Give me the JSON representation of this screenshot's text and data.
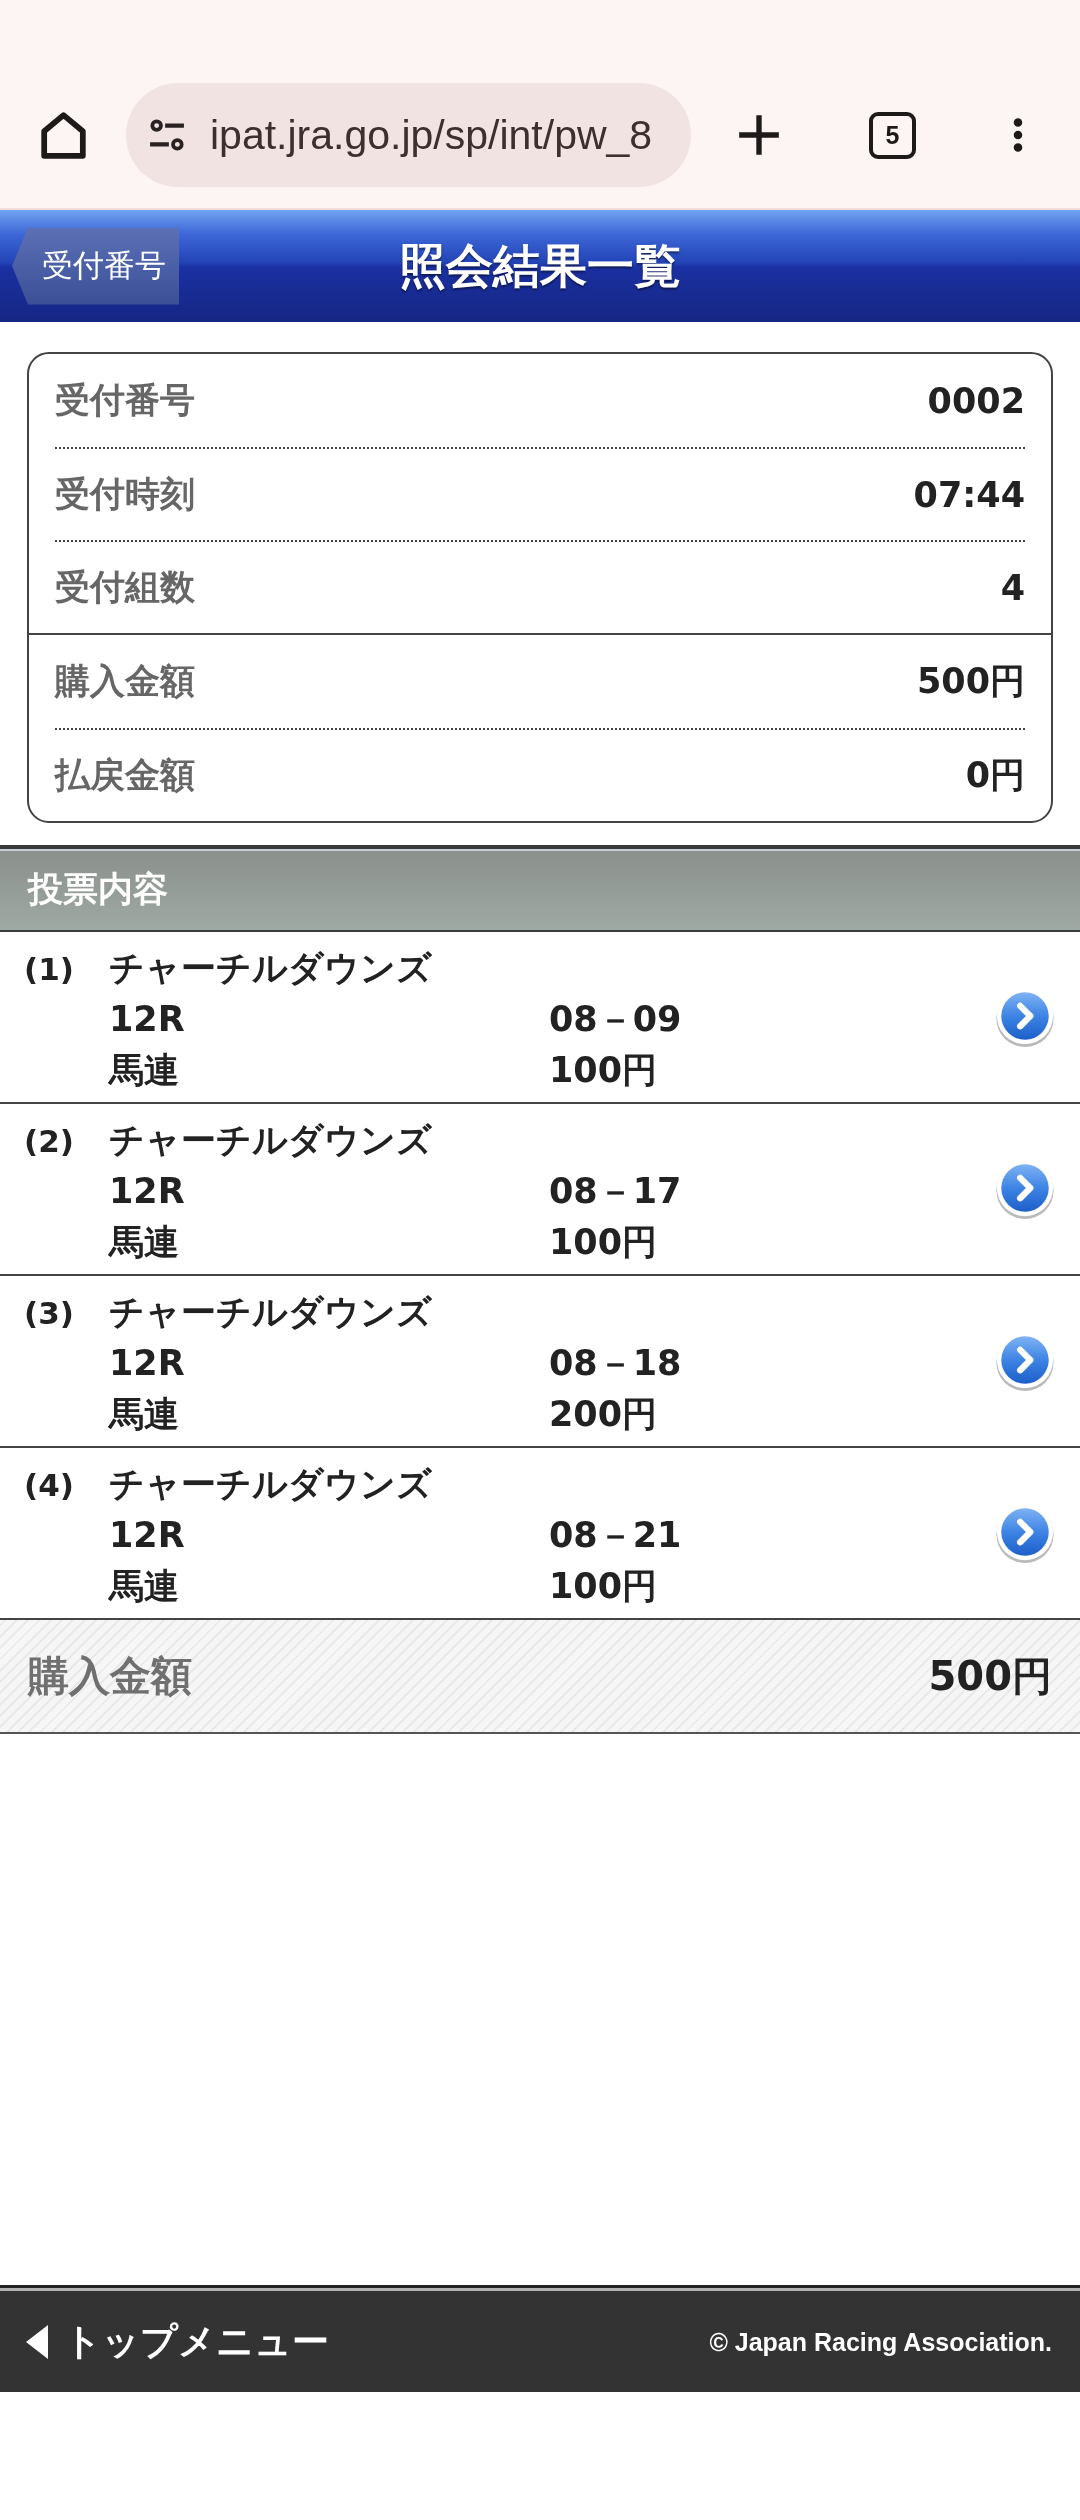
{
  "browser": {
    "url": "ipat.jra.go.jp/sp/int/pw_8",
    "tab_count": "5"
  },
  "header": {
    "back_button": "受付番号",
    "title": "照会結果一覧"
  },
  "summary": {
    "sections": [
      {
        "rows": [
          {
            "label": "受付番号",
            "value": "0002"
          },
          {
            "label": "受付時刻",
            "value": "07:44"
          },
          {
            "label": "受付組数",
            "value": "4"
          }
        ]
      },
      {
        "rows": [
          {
            "label": "購入金額",
            "value": "500円"
          },
          {
            "label": "払戻金額",
            "value": "0円"
          }
        ]
      }
    ]
  },
  "bets": {
    "title": "投票内容",
    "items": [
      {
        "number": "(1)",
        "venue": "チャーチルダウンズ",
        "race": "12R",
        "combination": "08－09",
        "bet_type": "馬連",
        "amount": "100円"
      },
      {
        "number": "(2)",
        "venue": "チャーチルダウンズ",
        "race": "12R",
        "combination": "08－17",
        "bet_type": "馬連",
        "amount": "100円"
      },
      {
        "number": "(3)",
        "venue": "チャーチルダウンズ",
        "race": "12R",
        "combination": "08－18",
        "bet_type": "馬連",
        "amount": "200円"
      },
      {
        "number": "(4)",
        "venue": "チャーチルダウンズ",
        "race": "12R",
        "combination": "08－21",
        "bet_type": "馬連",
        "amount": "100円"
      }
    ]
  },
  "total": {
    "label": "購入金額",
    "value": "500円"
  },
  "footer": {
    "top_menu_link": "トップメニュー",
    "copyright": "© Japan Racing Association."
  }
}
